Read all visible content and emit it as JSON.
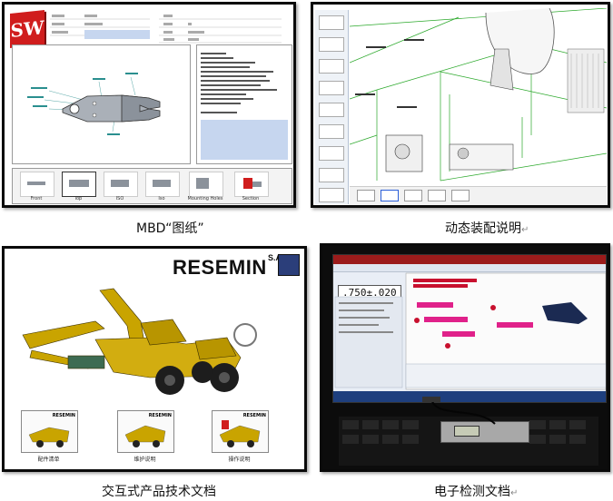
{
  "captions": {
    "mbd": "MBD“图纸”",
    "assembly": "动态装配说明",
    "interactive": "交互式产品技术文档",
    "inspection": "电子检测文档",
    "mark": "↵"
  },
  "mbd_panel": {
    "logo_text": "SW",
    "thumb_labels": [
      "Front",
      "Top",
      "ISO",
      "Iso",
      "Mounting Holes",
      "Section"
    ]
  },
  "interactive_panel": {
    "brand": "RESEMIN",
    "brand_suffix": "S.A.",
    "cards": [
      {
        "brand": "RESEMIN",
        "label": "配件清单"
      },
      {
        "brand": "RESEMIN",
        "label": "维护说明"
      },
      {
        "brand": "RESEMIN",
        "label": "操作说明"
      }
    ]
  },
  "inspection_panel": {
    "dimension": ".750±.020"
  },
  "colors": {
    "sw_red": "#d01d1d",
    "machine_yellow": "#c9a400",
    "cad_green": "#2aa82a",
    "screen_red": "#9b1b1b"
  }
}
